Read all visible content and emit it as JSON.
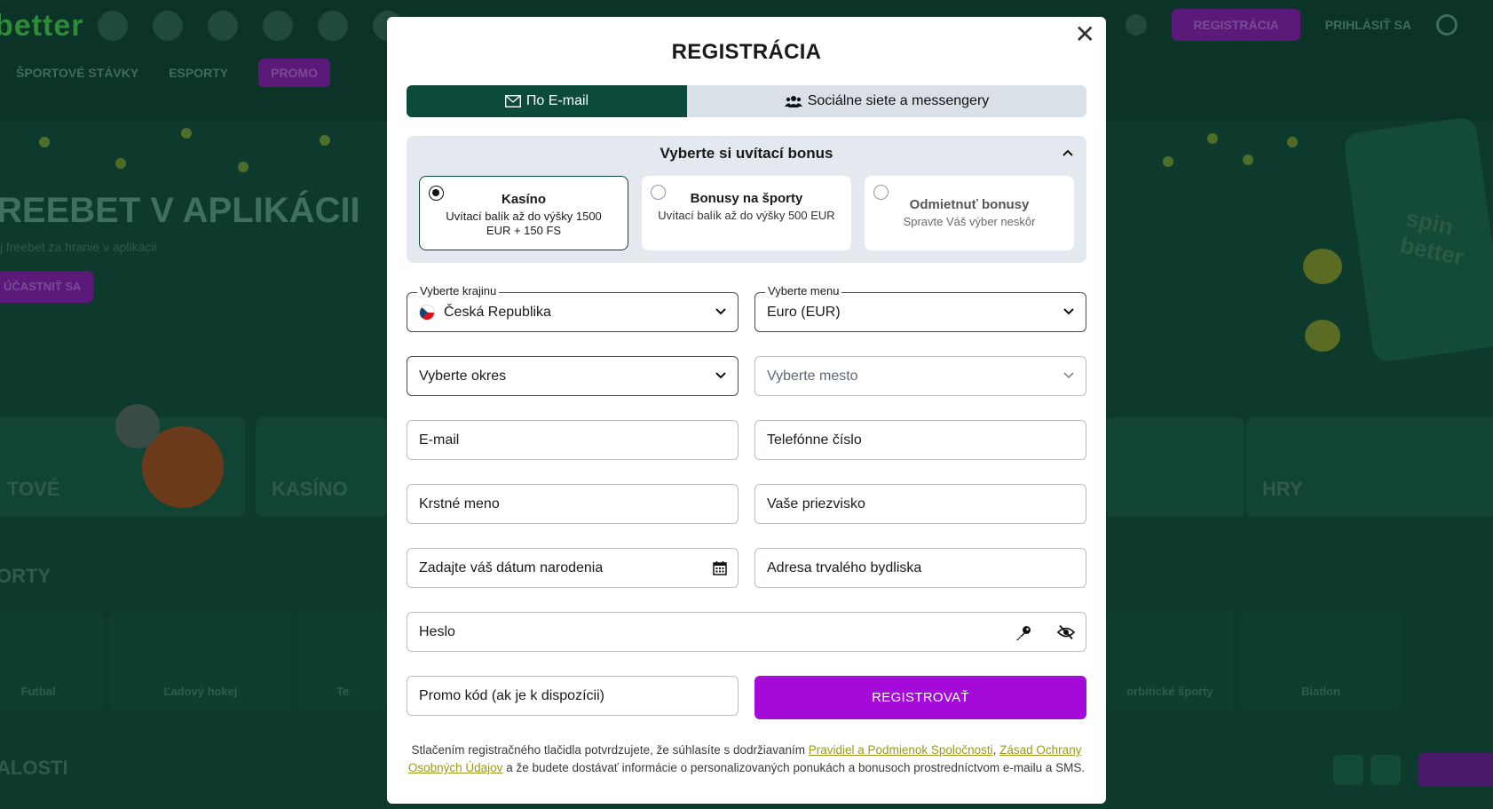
{
  "background": {
    "logo": "better",
    "nav": [
      "ŠPORTOVÉ STÁVKY",
      "ESPORTY",
      "PROMO"
    ],
    "header_register": "REGISTRÁCIA",
    "header_login": "PRIHLÁSIŤ SA",
    "hero_title": "REEBET V APLIKÁCII",
    "hero_sub": "j freebet za hranie v aplikácii",
    "hero_btn": "ÚČASTNIŤ SA",
    "categories": [
      "TOVÉ",
      "KASÍNO",
      "HRY"
    ],
    "section_sports": "ORTY",
    "section_events": "ALOSTI",
    "sports": [
      "Futbal",
      "Ľadový hokej",
      "Te",
      "orbitické športy",
      "Biatlon"
    ],
    "phone_text": "spin better"
  },
  "modal": {
    "title": "REGISTRÁCIA",
    "close": "✕",
    "tabs": {
      "email": "По E-mail",
      "social": "Sociálne siete a messengery"
    },
    "bonus": {
      "heading": "Vyberte si uvítací bonus",
      "options": [
        {
          "title": "Kasíno",
          "desc": "Uvítací balík až do výšky 1500 EUR + 150 FS",
          "selected": true
        },
        {
          "title": "Bonusy na športy",
          "desc": "Uvítací balík až do výšky 500 EUR",
          "selected": false
        },
        {
          "title": "Odmietnuť bonusy",
          "desc": "Spravte Váš výber neskôr",
          "selected": false
        }
      ]
    },
    "fields": {
      "country_label": "Vyberte krajinu",
      "country_value": "Česká Republika",
      "currency_label": "Vyberte menu",
      "currency_value": "Euro (EUR)",
      "district": "Vyberte okres",
      "city": "Vyberte mesto",
      "email": "E-mail",
      "phone": "Telefónne číslo",
      "first_name": "Krstné meno",
      "last_name": "Vaše priezvisko",
      "birthdate": "Zadajte váš dátum narodenia",
      "address": "Adresa trvalého bydliska",
      "password": "Heslo",
      "promo": "Promo kód (ak je k dispozícii)"
    },
    "submit": "REGISTROVAŤ",
    "disclaimer": {
      "part1": "Stlačením registračného tlačidla potvrdzujete, že súhlasíte s dodržiavaním ",
      "link1": "Pravidiel a Podmienok Spoločnosti",
      "sep": ", ",
      "link2": "Zásad Ochrany Osobných Údajov",
      "part2": " a že budete dostávať informácie o personalizovaných ponukách a bonusoch prostredníctvom e-mailu a SMS."
    }
  },
  "colors": {
    "primary_green": "#0c4a3a",
    "accent_purple": "#a40ad8",
    "link_yellow": "#9a9a1a"
  }
}
